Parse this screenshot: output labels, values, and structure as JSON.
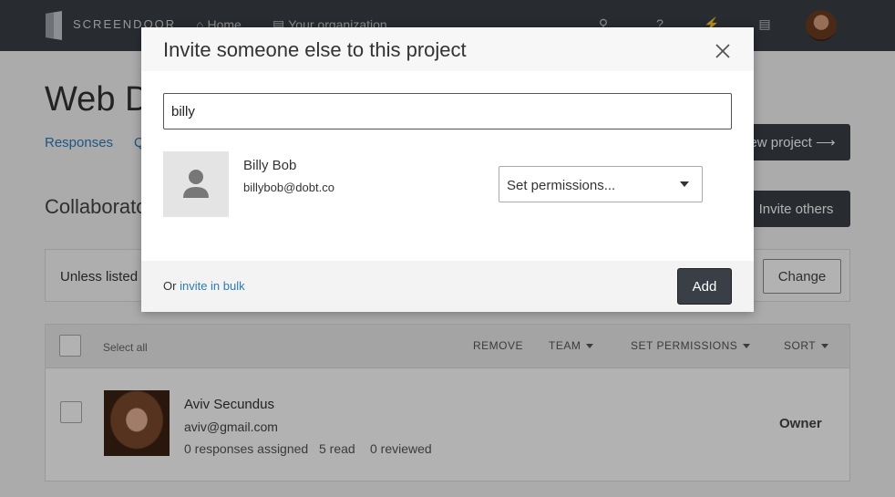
{
  "nav": {
    "logo_text": "SCREENDOOR",
    "home_label": "Home",
    "org_label": "Your organization",
    "icons": [
      "search-icon",
      "help-icon",
      "activity-icon",
      "document-icon"
    ]
  },
  "page": {
    "title": "Web D",
    "tabs": [
      "Responses",
      "Q"
    ],
    "view_project_label": "ew project ⟶",
    "section_title": "Collaborato",
    "invite_others_label": "Invite others",
    "notice_text": "Unless listed",
    "change_label": "Change"
  },
  "table": {
    "select_all_label": "Select all",
    "headers": {
      "remove": "REMOVE",
      "team": "TEAM",
      "set_permissions": "SET PERMISSIONS",
      "sort": "SORT"
    },
    "rows": [
      {
        "name": "Aviv Secundus",
        "email": "aviv@gmail.com",
        "assigned": "0 responses assigned",
        "read": "5 read",
        "reviewed": "0 reviewed",
        "role": "Owner"
      }
    ]
  },
  "modal": {
    "title": "Invite someone else to this project",
    "search_value": "billy",
    "result": {
      "name": "Billy Bob",
      "email": "billybob@dobt.co"
    },
    "permissions_placeholder": "Set permissions...",
    "footer_or": "Or",
    "bulk_link": "invite in bulk",
    "add_label": "Add"
  },
  "colors": {
    "nav_bg": "#3a3f47",
    "link": "#2b7bb9",
    "primary_button": "#3a3f47"
  }
}
